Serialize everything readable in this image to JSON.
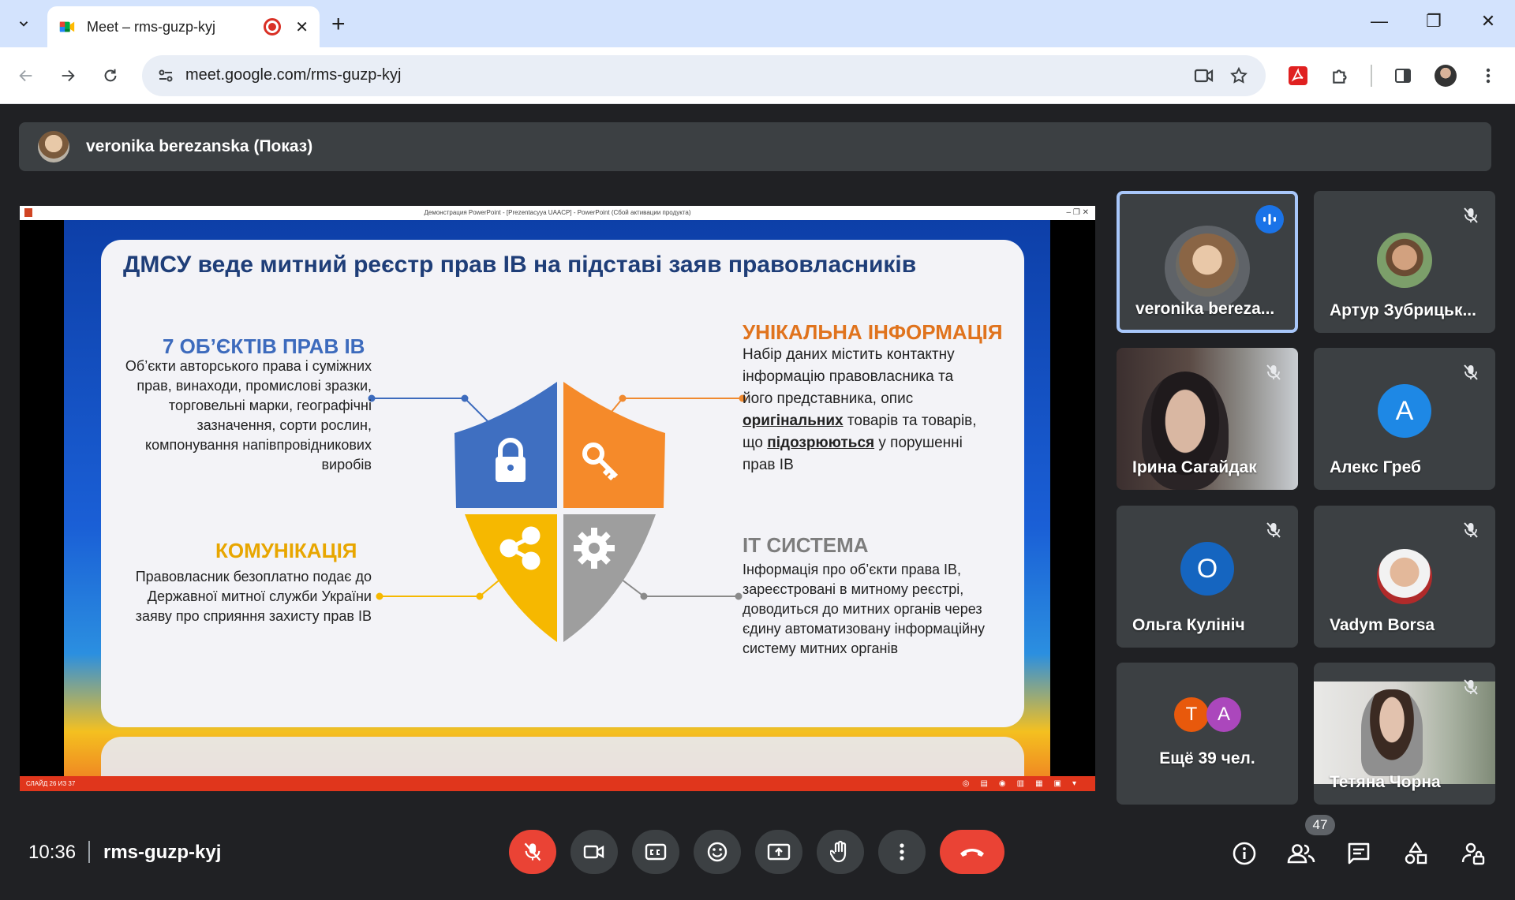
{
  "browser": {
    "tab_title": "Meet – rms-guzp-kyj",
    "url": "meet.google.com/rms-guzp-kyj"
  },
  "presenter_bar": {
    "label": "veronika berezanska (Показ)"
  },
  "slide": {
    "ppt_window_title": "Демонстрация PowerPoint - [Prezentacyya UAACP] - PowerPoint (Сбой активации продукта)",
    "heading": "ДМСУ веде митний реєстр прав ІВ на підставі заяв правовласників",
    "top_left": {
      "title": "7 ОБ’ЄКТІВ ПРАВ ІВ",
      "text_lines": [
        "Об’єкти авторського права і суміжних",
        "прав, винаходи, промислові зразки,",
        "торговельні марки, географічні",
        "зазначення, сорти рослин,",
        "компонування напівпровідникових",
        "виробів"
      ]
    },
    "top_right": {
      "title": "УНІКАЛЬНА ІНФОРМАЦІЯ",
      "line1": "Набір даних містить контактну",
      "line2": "інформацію правовласника та",
      "line3": "його представника, опис",
      "line4_bold": "оригінальних",
      "line4_rest": " товарів та товарів,",
      "line5_pre": "що ",
      "line5_bold": "підозрюються",
      "line5_rest": " у порушенні",
      "line6": "прав ІВ"
    },
    "bottom_left": {
      "title": "КОМУНІКАЦІЯ",
      "text_lines": [
        "Правовласник безоплатно подає до",
        "Державної митної служби України",
        "заяву про сприяння захисту прав ІВ"
      ]
    },
    "bottom_right": {
      "title": "ІТ СИСТЕМА",
      "text_lines": [
        "Інформація про об’єкти права ІВ,",
        "зареєстровані в митному реєстрі,",
        "доводиться до митних органів через",
        "єдину автоматизовану інформаційну",
        "систему митних органів"
      ]
    },
    "status_text": "СЛАЙД 26 ИЗ 37"
  },
  "participants": [
    {
      "name": "veronika bereza...",
      "speaking": true
    },
    {
      "name": "Артур Зубрицьк...",
      "muted": true
    },
    {
      "name": "Ірина Сагайдак",
      "muted": true
    },
    {
      "name": "Алекс Греб",
      "initial": "A",
      "color": "#1e88e5",
      "muted": true
    },
    {
      "name": "Ольга Кулініч",
      "initial": "O",
      "color": "#1565c0",
      "muted": true
    },
    {
      "name": "Vadym Borsa",
      "muted": true
    },
    {
      "name": "Ещё 39 чел.",
      "initials": [
        "T",
        "A"
      ],
      "colors": [
        "#e8590c",
        "#ab47bc"
      ]
    },
    {
      "name": "Тетяна Чорна",
      "muted": true
    }
  ],
  "bottom_bar": {
    "time": "10:36",
    "meeting_code": "rms-guzp-kyj",
    "participant_count": "47"
  },
  "colors": {
    "end_call": "#ea4335",
    "speaking_border": "#a8c7fa",
    "accent_blue": "#1a73e8"
  }
}
